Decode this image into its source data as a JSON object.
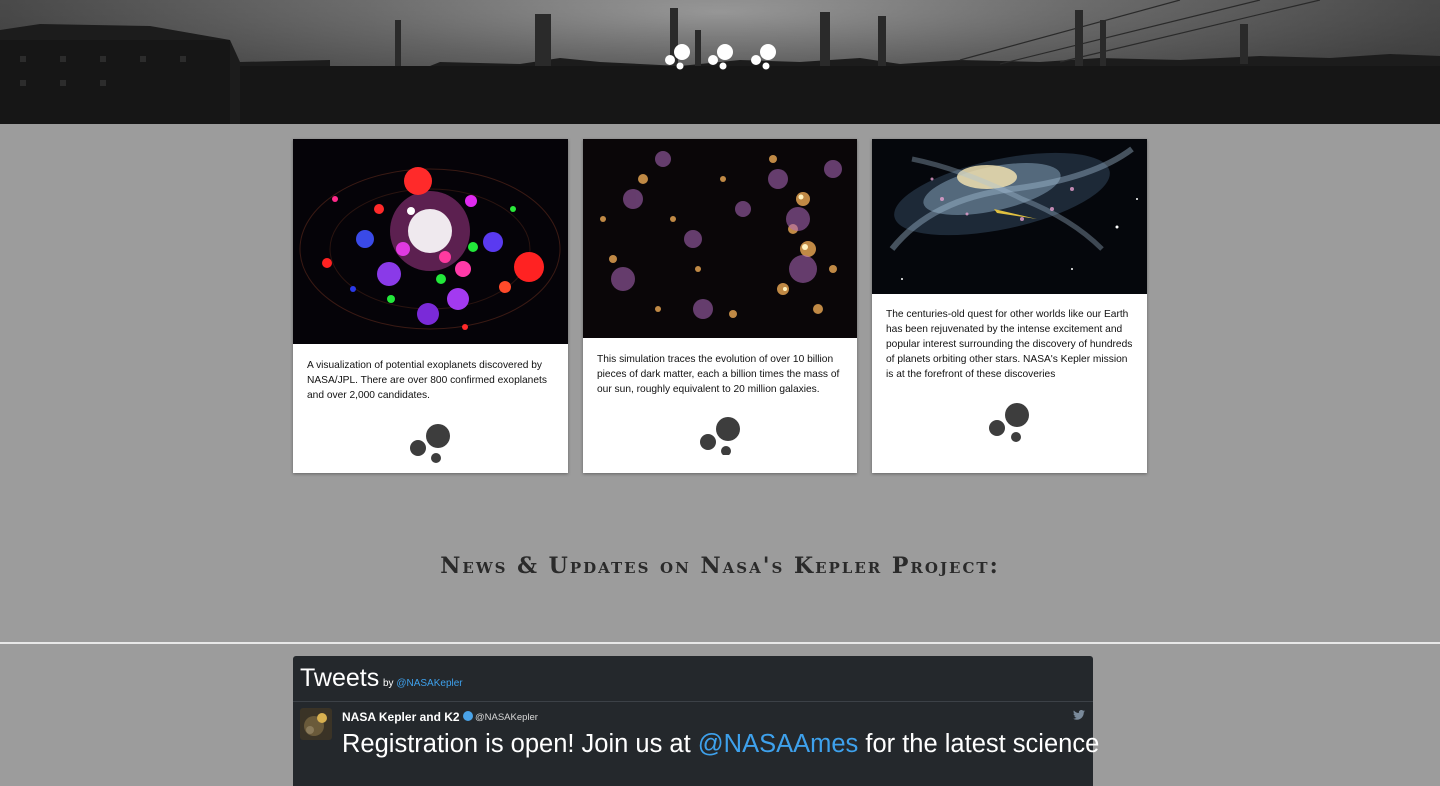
{
  "header": {
    "logo_icon": "bubbles-logo-icon"
  },
  "cards": [
    {
      "image": "exoplanet-visualization",
      "text": "A visualization of potential exoplanets discovered by NASA/JPL. There are over 800 confirmed exoplanets and over 2,000 candidates.",
      "icon": "bubbles-icon"
    },
    {
      "image": "dark-matter-simulation",
      "text": "This simulation traces the evolution of over 10 billion pieces of dark matter, each a billion times the mass of our sun, roughly equivalent to 20 million galaxies.",
      "icon": "bubbles-icon"
    },
    {
      "image": "spiral-galaxy",
      "text": "The centuries-old quest for other worlds like our Earth has been rejuvenated by the intense excitement and popular interest surrounding the discovery of hundreds of planets orbiting other stars. NASA's Kepler mission is at the forefront of these discoveries",
      "icon": "bubbles-icon"
    }
  ],
  "news": {
    "title": "News & Updates on Nasa's Kepler Project:"
  },
  "tweets": {
    "title": "Tweets",
    "by": "by",
    "handle": "@NASAKepler",
    "tweet": {
      "name": "NASA Kepler and K2",
      "user": "@NASAKepler",
      "text_before": "Registration is open! Join us at ",
      "mention": "@NASAAmes",
      "text_after": " for the latest science"
    }
  },
  "colors": {
    "page_bg": "#9c9c9c",
    "tweet_bg": "#24282c",
    "link": "#3ea1ec",
    "icon": "#3d3d3d"
  }
}
